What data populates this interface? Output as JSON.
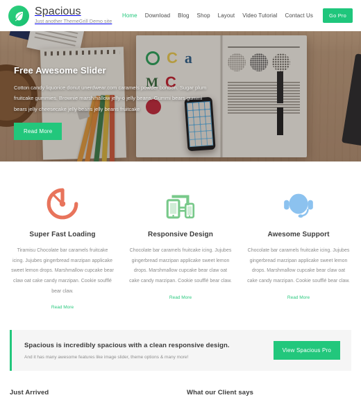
{
  "theme": {
    "accent_green": "#22c77c",
    "icon_coral": "#e8745c",
    "icon_green": "#78c98a",
    "icon_blue": "#8cc2ef",
    "banner_bg": "#f5f5f5"
  },
  "header": {
    "logo_icon": "leaf-logo-icon",
    "site_title": "Spacious",
    "site_description": "Just another ThemeGrill Demo site",
    "nav": [
      {
        "label": "Home",
        "active": true
      },
      {
        "label": "Download",
        "active": false
      },
      {
        "label": "Blog",
        "active": false
      },
      {
        "label": "Shop",
        "active": false
      },
      {
        "label": "Layout",
        "active": false
      },
      {
        "label": "Video Tutorial",
        "active": false
      },
      {
        "label": "Contact Us",
        "active": false
      }
    ],
    "go_pro_label": "Go Pro"
  },
  "slider": {
    "title": "Free Awesome Slider",
    "body": "Cotton candy liquorice donut unerdwear.com caramels powder bonbon. Sugar plum fruitcake gummies. Brownie marshmallow jelly-o jelly beans. Gummi bears gummi bears jelly cheesecake jelly beans jelly beans fruitcake",
    "button_label": "Read More"
  },
  "features": [
    {
      "icon": "speedometer-icon",
      "title": "Super Fast Loading",
      "text": "Tiramisu Chocolate bar caramels fruitcake icing. Jujubes gingerbread marzipan applicake sweet lemon drops. Marshmallow cupcake bear claw oat cake candy marzipan. Cookie soufflé bear claw.",
      "read_more": "Read More"
    },
    {
      "icon": "responsive-devices-icon",
      "title": "Responsive Design",
      "text": "Chocolate bar caramels fruitcake icing. Jujubes gingerbread marzipan applicake sweet lemon drops. Marshmallow cupcake bear claw oat cake candy marzipan. Cookie soufflé bear claw.",
      "read_more": "Read More"
    },
    {
      "icon": "headset-support-icon",
      "title": "Awesome Support",
      "text": "Chocolate bar caramels fruitcake icing. Jujubes gingerbread marzipan applicake sweet lemon drops. Marshmallow cupcake bear claw oat cake candy marzipan. Cookie soufflé bear claw.",
      "read_more": "Read More"
    }
  ],
  "cta": {
    "title": "Spacious is incredibly spacious with a clean responsive design.",
    "subtitle": "And it has many awesome features like image slider, theme options & many more!",
    "button_label": "View Spacious Pro"
  },
  "bottom": {
    "left_heading": "Just Arrived",
    "right_heading": "What our Client says"
  }
}
